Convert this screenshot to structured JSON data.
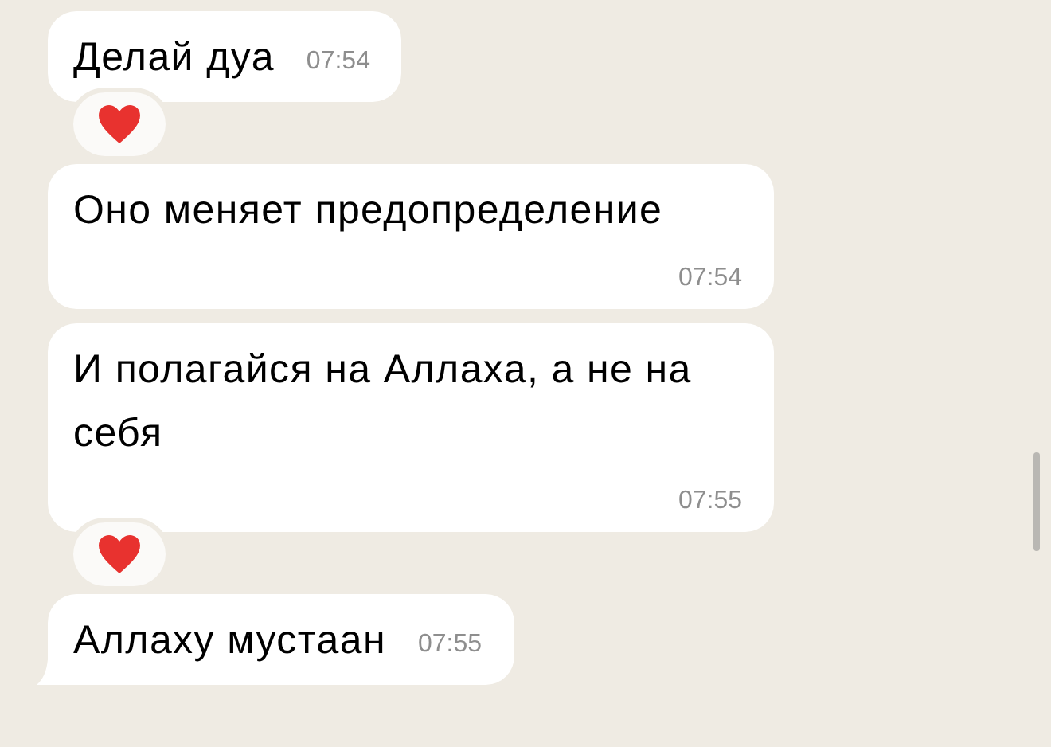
{
  "messages": [
    {
      "text": "Делай дуа",
      "time": "07:54",
      "reacted": true,
      "tail": false
    },
    {
      "text": "Оно меняет предопределение",
      "time": "07:54",
      "reacted": false,
      "tail": false
    },
    {
      "text": "И полагайся на Аллаха, а не на себя",
      "time": "07:55",
      "reacted": true,
      "tail": false
    },
    {
      "text": "Аллаху мустаан",
      "time": "07:55",
      "reacted": false,
      "tail": true
    }
  ]
}
